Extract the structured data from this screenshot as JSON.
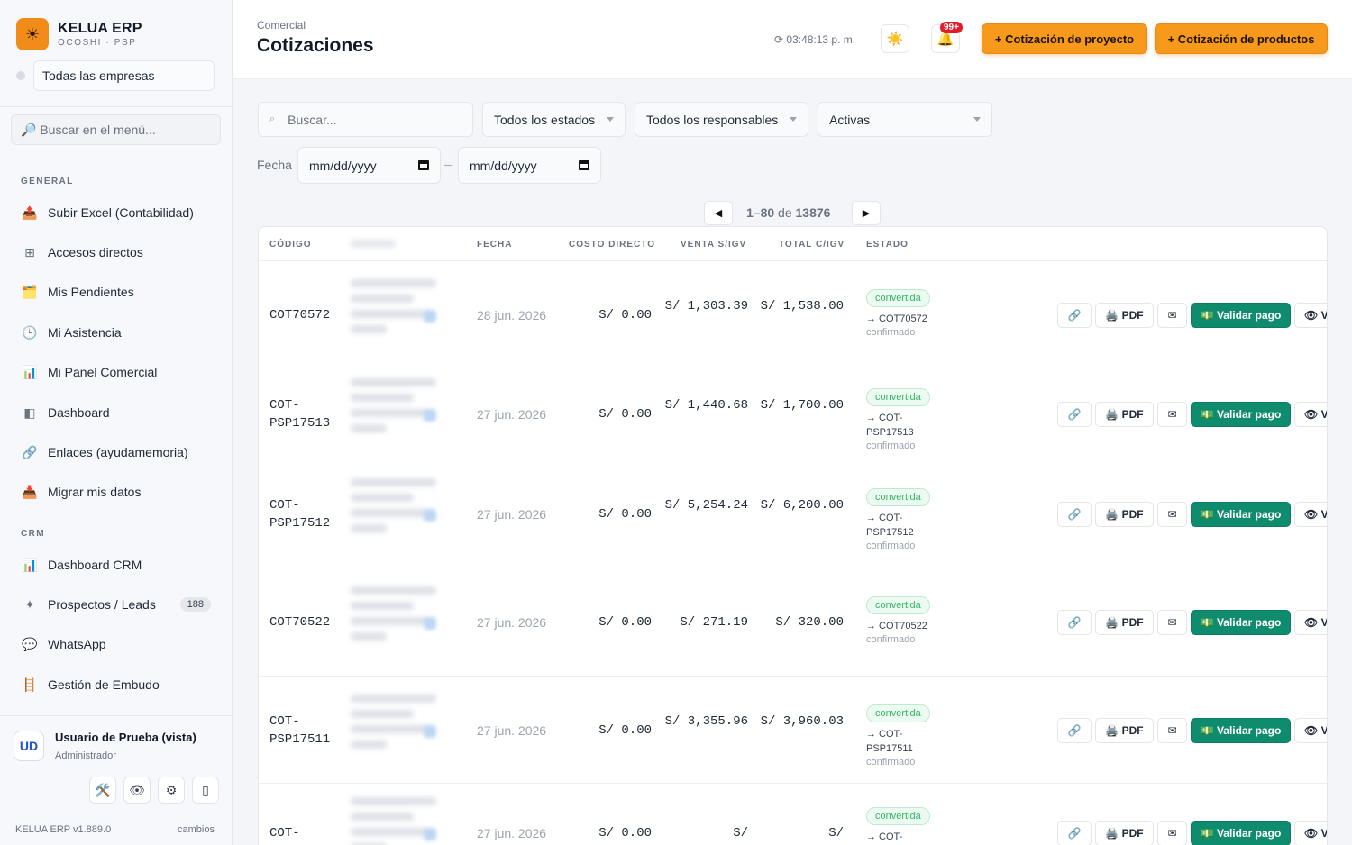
{
  "app": {
    "name": "KELUA ERP",
    "subtitle": "OCOSHI · PSP",
    "logo_icon": "sun-icon",
    "version": "KELUA ERP v1.889.0",
    "changes_label": "cambios"
  },
  "sidebar": {
    "company_select": "Todas las empresas",
    "search_placeholder": "🔎 Buscar en el menú...",
    "sections": {
      "general": "GENERAL",
      "crm": "CRM"
    },
    "items": [
      {
        "icon": "📤",
        "label": "Subir Excel (Contabilidad)"
      },
      {
        "icon": "⊞",
        "label": "Accesos directos"
      },
      {
        "icon": "🗂️",
        "label": "Mis Pendientes"
      },
      {
        "icon": "🕒",
        "label": "Mi Asistencia"
      },
      {
        "icon": "📊",
        "label": "Mi Panel Comercial"
      },
      {
        "icon": "◧",
        "label": "Dashboard"
      },
      {
        "icon": "🔗",
        "label": "Enlaces (ayudamemoria)"
      },
      {
        "icon": "📥",
        "label": "Migrar mis datos"
      },
      {
        "icon": "📊",
        "label": "Dashboard CRM"
      },
      {
        "icon": "✦",
        "label": "Prospectos / Leads",
        "badge": "188"
      },
      {
        "icon": "💬",
        "label": "WhatsApp"
      },
      {
        "icon": "🪜",
        "label": "Gestión de Embudo"
      }
    ],
    "user": {
      "initials": "UD",
      "name": "Usuario de Prueba (vista)",
      "role": "Administrador",
      "actions": [
        "🛠️",
        "👁",
        "⚙",
        "▯"
      ]
    }
  },
  "header": {
    "breadcrumb": "Comercial",
    "title": "Cotizaciones",
    "clock": "⟳ 03:48:13 p. m.",
    "theme_icon": "☀️",
    "bell_icon": "🔔",
    "notif_count": "99+",
    "btn_project": "+ Cotización de proyecto",
    "btn_products": "+ Cotización de productos"
  },
  "filters": {
    "search_placeholder": "Buscar...",
    "search_icon": "⌕",
    "estado": "Todos los estados",
    "responsable": "Todos los responsables",
    "activas": "Activas",
    "fecha_label": "Fecha",
    "date_from": "mm/dd/yyyy",
    "date_to": "mm/dd/yyyy",
    "date_sep": "–"
  },
  "pager": {
    "prev": "◀",
    "next": "▶",
    "range": "1–80",
    "of": "de",
    "total": "13876"
  },
  "table": {
    "columns": {
      "codigo": "CÓDIGO",
      "fecha": "FECHA",
      "costo": "COSTO DIRECTO",
      "venta": "VENTA S/IGV",
      "total": "TOTAL C/IGV",
      "estado": "ESTADO"
    },
    "actions": {
      "link": "🔗",
      "pdf": "🖨️ PDF",
      "mail": "✉",
      "validar": "💵 Validar pago",
      "view": "👁 V"
    },
    "rows": [
      {
        "code": "COT70572",
        "fecha": "28 jun. 2026",
        "costo": "S/ 0.00",
        "venta": "S/ 1,303.39",
        "total": "S/ 1,538.00",
        "estado": "convertida",
        "conv": "→ COT70572",
        "confirm": "confirmado"
      },
      {
        "code": "COT-PSP17513",
        "fecha": "27 jun. 2026",
        "costo": "S/ 0.00",
        "venta": "S/ 1,440.68",
        "total": "S/ 1,700.00",
        "estado": "convertida",
        "conv": "→ COT-PSP17513",
        "confirm": "confirmado"
      },
      {
        "code": "COT-PSP17512",
        "fecha": "27 jun. 2026",
        "costo": "S/ 0.00",
        "venta": "S/ 5,254.24",
        "total": "S/ 6,200.00",
        "estado": "convertida",
        "conv": "→ COT-PSP17512",
        "confirm": "confirmado"
      },
      {
        "code": "COT70522",
        "fecha": "27 jun. 2026",
        "costo": "S/ 0.00",
        "venta": "S/ 271.19",
        "total": "S/ 320.00",
        "estado": "convertida",
        "conv": "→ COT70522",
        "confirm": "confirmado"
      },
      {
        "code": "COT-PSP17511",
        "fecha": "27 jun. 2026",
        "costo": "S/ 0.00",
        "venta": "S/ 3,355.96",
        "total": "S/ 3,960.03",
        "estado": "convertida",
        "conv": "→ COT-PSP17511",
        "confirm": "confirmado"
      },
      {
        "code": "COT-",
        "fecha": "27 jun. 2026",
        "costo": "S/ 0.00",
        "venta": "S/",
        "total": "S/",
        "estado": "convertida",
        "conv": "→ COT-",
        "confirm": ""
      }
    ]
  }
}
